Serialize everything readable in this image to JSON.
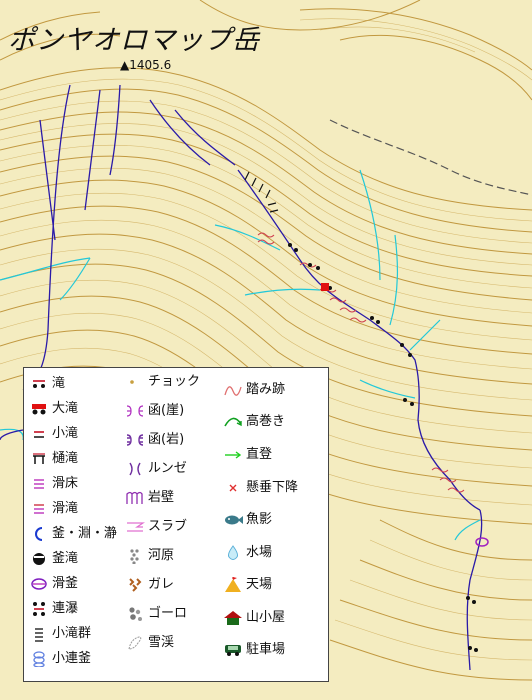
{
  "title": "ポンヤオロマップ岳",
  "summit_label": "▲1405.6",
  "legend": {
    "col1": [
      "滝",
      "大滝",
      "小滝",
      "樋滝",
      "滑床",
      "滑滝",
      "釜・淵・瀞",
      "釜滝",
      "滑釜",
      "連瀑",
      "小滝群",
      "小連釜"
    ],
    "col2": [
      "チョック",
      "函(崖)",
      "函(岩)",
      "ルンゼ",
      "岩壁",
      "スラブ",
      "河原",
      "ガレ",
      "ゴーロ",
      "雪渓"
    ],
    "col3": [
      "踏み跡",
      "高巻き",
      "直登",
      "懸垂下降",
      "魚影",
      "水場",
      "天場",
      "山小屋",
      "駐車場"
    ]
  },
  "colors": {
    "background": "#f4ecc0",
    "contour": "#b98a2a",
    "stream": "#2a1aa8",
    "tributary": "#22c8d8",
    "trail_marks": "#d04050"
  }
}
